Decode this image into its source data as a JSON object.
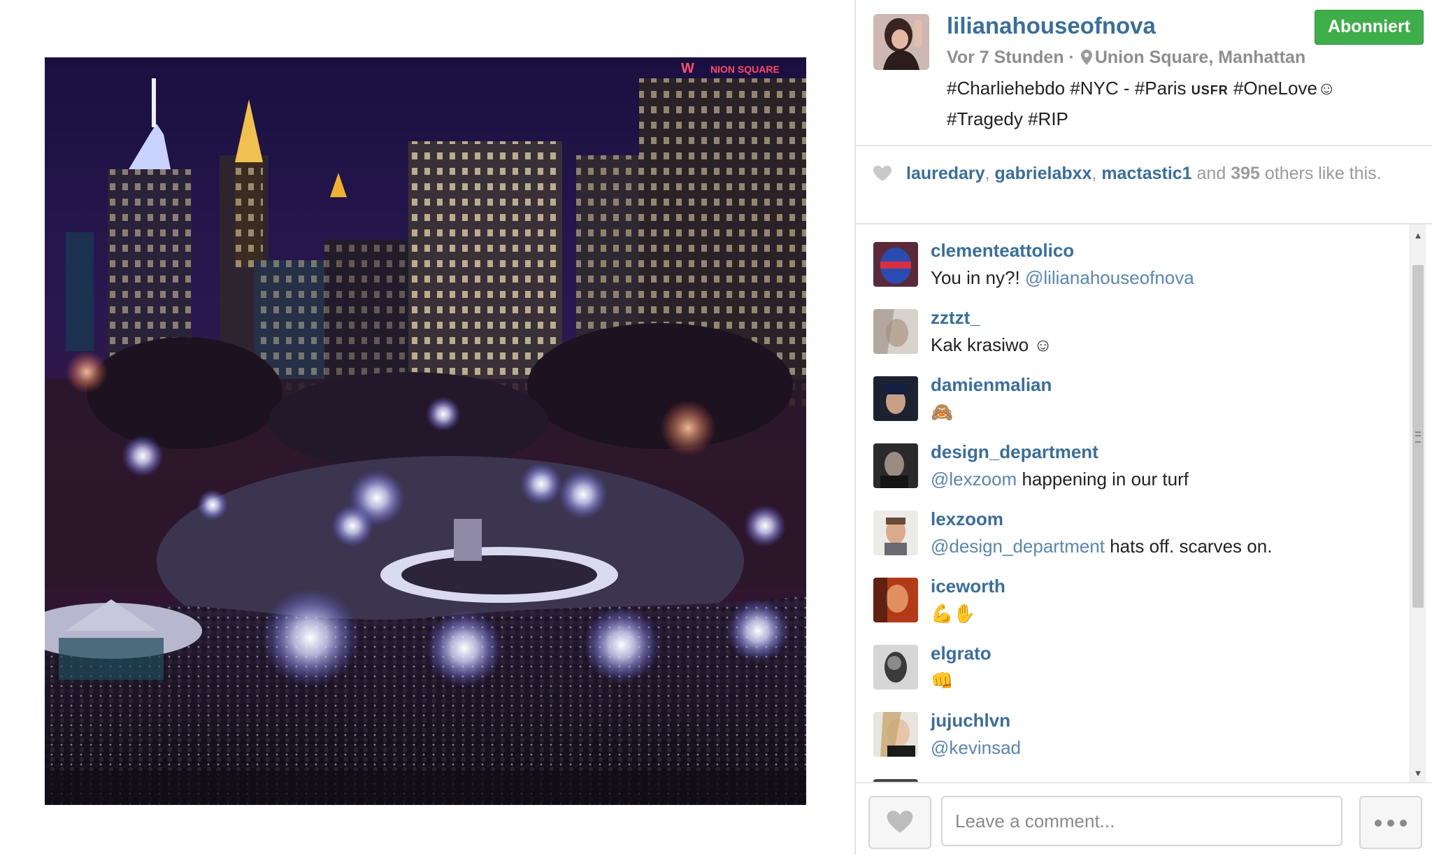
{
  "post": {
    "username": "lilianahouseofnova",
    "follow_label": "Abonniert",
    "time_ago": "Vor 7 Stunden ·",
    "location": "Union Square, Manhattan",
    "caption_part1": "#Charliehebdo #NYC - #Paris ",
    "caption_flag": "USFR",
    "caption_part2": " #OneLove☺",
    "caption_line2": "#Tragedy #RIP",
    "photo_sign_text": "NION SQUARE",
    "photo_sign_logo": "W"
  },
  "likes": {
    "user1": "lauredary",
    "user2": "gabrielabxx",
    "user3": "mactastic1",
    "and_text": " and ",
    "count": "395",
    "suffix": " others like this.",
    "sep": ", "
  },
  "comments": [
    {
      "user": "clementeattolico",
      "text": "You in ny?! ",
      "mention": "@lilianahouseofnova",
      "after": ""
    },
    {
      "user": "zztzt_",
      "text": "Kak krasiwo ☺",
      "mention": "",
      "after": ""
    },
    {
      "user": "damienmalian",
      "text": "🙈",
      "mention": "",
      "after": ""
    },
    {
      "user": "design_department",
      "text": "",
      "mention": "@lexzoom",
      "after": " happening in our turf"
    },
    {
      "user": "lexzoom",
      "text": "",
      "mention": "@design_department",
      "after": " hats off. scarves on."
    },
    {
      "user": "iceworth",
      "text": "💪✋",
      "mention": "",
      "after": ""
    },
    {
      "user": "elgrato",
      "text": "👊",
      "mention": "",
      "after": ""
    },
    {
      "user": "jujuchlvn",
      "text": "",
      "mention": "@kevinsad",
      "after": ""
    }
  ],
  "footer": {
    "comment_placeholder": "Leave a comment..."
  },
  "colors": {
    "username": "#3b6e99",
    "follow_green": "#3fae4a",
    "meta_gray": "#8e8e8e"
  },
  "icons": [
    "heart-icon",
    "location-pin-icon",
    "more-options-icon",
    "scroll-up-icon",
    "scroll-down-icon"
  ]
}
